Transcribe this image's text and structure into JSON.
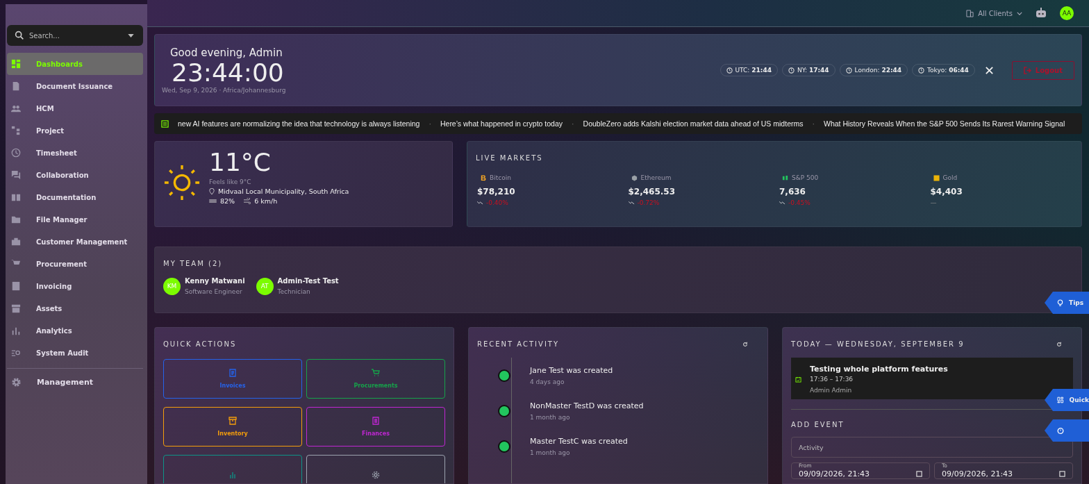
{
  "sidebar": {
    "search": {
      "placeholder": "Search..."
    },
    "items": [
      {
        "label": "Dashboards",
        "selected": true
      },
      {
        "label": "Document Issuance",
        "selected": false
      },
      {
        "label": "HCM",
        "selected": false
      },
      {
        "label": "Project",
        "selected": false
      },
      {
        "label": "Timesheet",
        "selected": false
      },
      {
        "label": "Collaboration",
        "selected": false
      },
      {
        "label": "Documentation",
        "selected": false
      },
      {
        "label": "File Manager",
        "selected": false
      },
      {
        "label": "Customer Management",
        "selected": false
      },
      {
        "label": "Procurement",
        "selected": false
      },
      {
        "label": "Invoicing",
        "selected": false
      },
      {
        "label": "Assets",
        "selected": false
      },
      {
        "label": "Analytics",
        "selected": false
      },
      {
        "label": "System Audit",
        "selected": false
      }
    ],
    "footer_item": {
      "label": "Management"
    }
  },
  "topbar": {
    "client_selector": "All Clients",
    "avatar": "AA"
  },
  "hero": {
    "greeting": "Good evening, Admin",
    "time": "23:44:00",
    "date": "Wed, Sep 9, 2026 · Africa/Johannesburg",
    "clocks": [
      {
        "city": "UTC:",
        "time": "21:44"
      },
      {
        "city": "NY:",
        "time": "17:44"
      },
      {
        "city": "London:",
        "time": "22:44"
      },
      {
        "city": "Tokyo:",
        "time": "06:44"
      }
    ],
    "logout": "Logout"
  },
  "ticker": [
    "new AI features are normalizing the idea that technology is always listening",
    "Here’s what happened in crypto today",
    "DoubleZero adds Kalshi election market data ahead of US midterms",
    "What History Reveals When the S&P 500 Sends Its Rarest Warning Signal"
  ],
  "ticker_separator": "·",
  "weather": {
    "temperature": "11°C",
    "feels_like": "Feels like 9°C",
    "location": "Midvaal Local Municipality, South Africa",
    "humidity": "82%",
    "wind": "6 km/h"
  },
  "markets": {
    "title": "LIVE MARKETS",
    "items": [
      {
        "name": "Bitcoin",
        "color": "#f5a623",
        "price": "$78,210",
        "change": "-0.40%",
        "kind": "down"
      },
      {
        "name": "Ethereum",
        "color": "#9aa0a6",
        "price": "$2,465.53",
        "change": "-0.72%",
        "kind": "down"
      },
      {
        "name": "S&P 500",
        "color": "#22c55e",
        "price": "7,636",
        "change": "-0.45%",
        "kind": "down"
      },
      {
        "name": "Gold",
        "color": "#eab308",
        "price": "$4,403",
        "change": "—",
        "kind": "flat"
      }
    ]
  },
  "team": {
    "title": "MY TEAM (2)",
    "members": [
      {
        "initials": "KM",
        "name": "Kenny Matwani",
        "role": "Software Engineer"
      },
      {
        "initials": "AT",
        "name": "Admin-Test Test",
        "role": "Technician"
      }
    ]
  },
  "quick_actions": {
    "title": "QUICK ACTIONS",
    "items": [
      {
        "label": "Invoices",
        "color": "#2563eb"
      },
      {
        "label": "Procurements",
        "color": "#16a34a"
      },
      {
        "label": "Inventory",
        "color": "#f59e0b"
      },
      {
        "label": "Finances",
        "color": "#c026d3"
      },
      {
        "color": "#0d9488"
      },
      {
        "color": "#9ca3af"
      }
    ]
  },
  "activity": {
    "title": "RECENT ACTIVITY",
    "items": [
      {
        "text": "Jane Test was created",
        "time": "4 days ago"
      },
      {
        "text": "NonMaster TestD was created",
        "time": "1 month ago"
      },
      {
        "text": "Master TestC was created",
        "time": "1 month ago"
      }
    ]
  },
  "today": {
    "title": "TODAY — WEDNESDAY, SEPTEMBER 9",
    "event": {
      "title": "Testing whole platform features",
      "time": "17:36 – 17:36",
      "owner": "Admin Admin"
    },
    "add_event": {
      "title": "ADD EVENT",
      "activity_placeholder": "Activity",
      "from_label": "From",
      "from_value": "09/09/2026, 21:43",
      "to_label": "To",
      "to_value": "09/09/2026, 21:43"
    }
  },
  "floating_tabs": [
    {
      "kind": "tips",
      "label": "Tips"
    },
    {
      "kind": "quick",
      "label": "Quick"
    },
    {
      "kind": "timer"
    }
  ]
}
